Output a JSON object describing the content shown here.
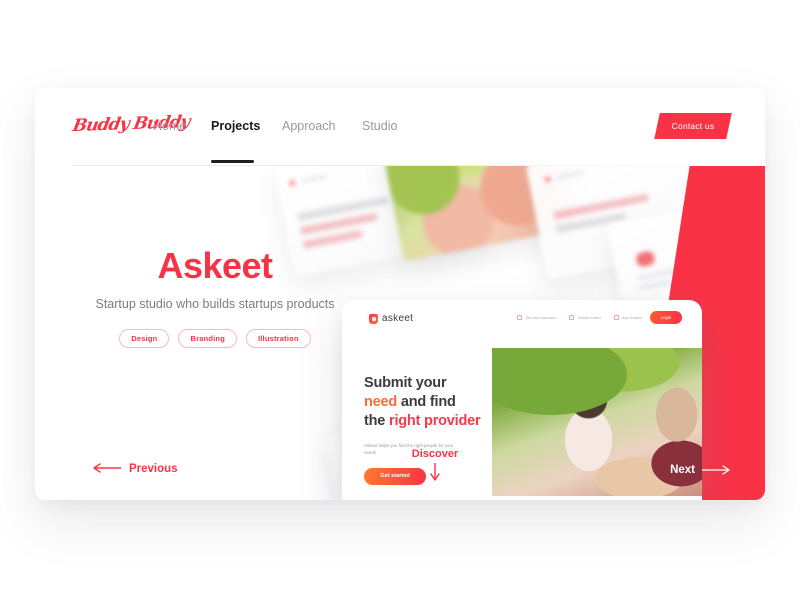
{
  "brand": {
    "logo_text": "Buddy Buddy"
  },
  "nav": {
    "items": [
      {
        "label": "Home",
        "active": false
      },
      {
        "label": "Projects",
        "active": true
      },
      {
        "label": "Approach",
        "active": false
      },
      {
        "label": "Studio",
        "active": false
      }
    ],
    "cta_label": "Contact us"
  },
  "hero": {
    "title": "Askeet",
    "subtitle": "Startup studio who builds startups products",
    "tags": [
      "Design",
      "Branding",
      "Illustration"
    ]
  },
  "controls": {
    "previous_label": "Previous",
    "next_label": "Next",
    "discover_label": "Discover"
  },
  "mockup": {
    "logo_text": "askeet",
    "nav_items": [
      "Get new customers",
      "Submit a need",
      "How it works"
    ],
    "login_label": "Login",
    "headline_line1": "Submit your",
    "headline_line2_accent": "need",
    "headline_line2_rest": "and find",
    "headline_line3_prefix": "the",
    "headline_line3_accent": "right provider",
    "paragraph": "Askeet helps you find the right people for your needs",
    "cta_label": "Get started"
  },
  "colors": {
    "brand_red": "#FA3246",
    "accent_orange": "#FF6B35",
    "text_dark": "#1a1a1a",
    "text_muted": "#9a9a9e"
  }
}
